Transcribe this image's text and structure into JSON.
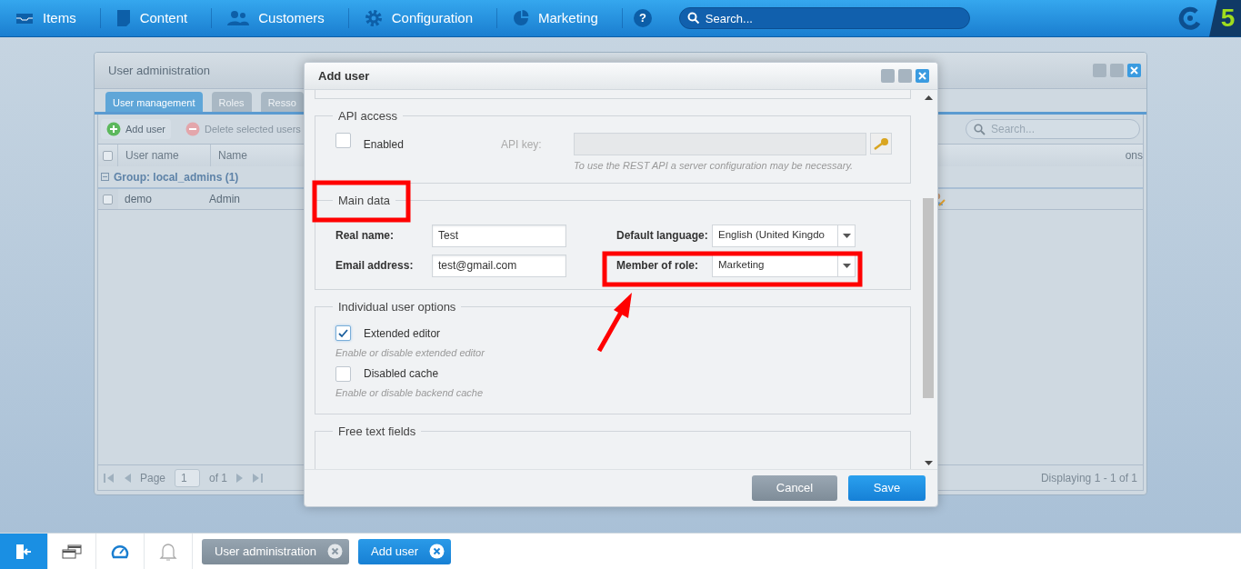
{
  "topbar": {
    "menu": [
      {
        "label": "Items"
      },
      {
        "label": "Content"
      },
      {
        "label": "Customers"
      },
      {
        "label": "Configuration"
      },
      {
        "label": "Marketing"
      }
    ],
    "help": "?",
    "search": {
      "placeholder": "Search..."
    },
    "logo": "5"
  },
  "user_admin": {
    "title": "User administration",
    "tabs": [
      {
        "label": "User management",
        "selected": true
      },
      {
        "label": "Roles",
        "selected": false
      },
      {
        "label": "Resso",
        "selected": false
      }
    ],
    "add_button": {
      "label": "Add user",
      "disabled": false
    },
    "delete_button": {
      "label": "Delete selected users",
      "disabled": true
    },
    "search": {
      "placeholder": "Search..."
    },
    "select_all": {
      "checked": false
    },
    "columns": [
      {
        "label": "User name"
      },
      {
        "label": "Name"
      },
      {
        "label": "ons"
      }
    ],
    "group": {
      "label": "Group: local_admins (1)",
      "expanded": true
    },
    "rows": [
      {
        "user_name": "demo",
        "name": "Admin",
        "checked": false
      }
    ],
    "paging": {
      "page_label": "Page",
      "page": "1",
      "of": "of 1",
      "display": "Displaying 1 - 1 of 1"
    }
  },
  "add_user_dialog": {
    "title": "Add user",
    "sections": [
      {
        "kind": "api",
        "legend": "API access",
        "enabled": {
          "label": "Enabled",
          "checked": false
        },
        "api_key": {
          "label": "API key:",
          "disabled": true,
          "hint": "To use the REST API a server configuration may be necessary."
        }
      },
      {
        "kind": "main",
        "legend": "Main data",
        "fields": [
          {
            "label": "Real name:",
            "value": "Test"
          },
          {
            "label": "Email address:",
            "value": "test@gmail.com"
          }
        ],
        "selects": [
          {
            "label": "Default language:",
            "value": "English (United Kingdo"
          },
          {
            "label": "Member of role:",
            "value": "Marketing"
          }
        ]
      },
      {
        "kind": "options",
        "legend": "Individual user options",
        "options": [
          {
            "label": "Extended editor",
            "checked": true,
            "hint": "Enable or disable extended editor"
          },
          {
            "label": "Disabled cache",
            "checked": false,
            "hint": "Enable or disable backend cache"
          }
        ]
      },
      {
        "kind": "legend_only",
        "legend": "Free text fields"
      }
    ],
    "buttons": [
      {
        "label": "Cancel",
        "kind": "secondary"
      },
      {
        "label": "Save",
        "kind": "primary"
      }
    ]
  },
  "taskbar": {
    "tasks": [
      {
        "label": "User administration",
        "selected": false
      },
      {
        "label": "Add user",
        "selected": true
      }
    ]
  }
}
